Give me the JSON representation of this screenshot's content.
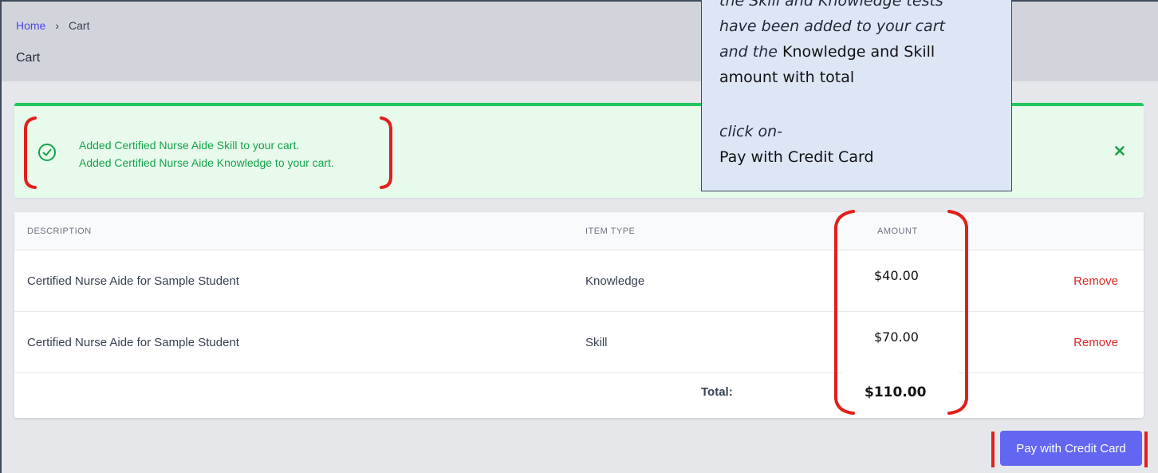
{
  "breadcrumb": {
    "home": "Home",
    "separator": "›",
    "current": "Cart"
  },
  "page_title": "Cart",
  "alert": {
    "icon": "check-circle-icon",
    "messages": [
      "Added Certified Nurse Aide Skill to your cart.",
      "Added Certified Nurse Aide Knowledge to your cart."
    ],
    "close_icon": "close-icon"
  },
  "table": {
    "headers": {
      "description": "DESCRIPTION",
      "item_type": "ITEM TYPE",
      "amount": "AMOUNT"
    },
    "rows": [
      {
        "description": "Certified Nurse Aide for Sample Student",
        "item_type": "Knowledge",
        "amount": "$40.00",
        "action": "Remove"
      },
      {
        "description": "Certified Nurse Aide for Sample Student",
        "item_type": "Skill",
        "amount": "$70.00",
        "action": "Remove"
      }
    ],
    "total_label": "Total:",
    "total_amount": "$110.00"
  },
  "pay_button": "Pay with Credit Card",
  "callout": {
    "line1": "the Skill and Knowledge tests",
    "line2": "have been added to your cart",
    "line3_italic": "and the",
    "line3_bold": "Knowledge and Skill",
    "line4": "amount with total",
    "line5": "click on-",
    "line6": "Pay with Credit Card"
  },
  "colors": {
    "accent": "#6366f1",
    "success": "#22c55e",
    "danger": "#dc2626",
    "annotation_red": "#e0201b"
  }
}
